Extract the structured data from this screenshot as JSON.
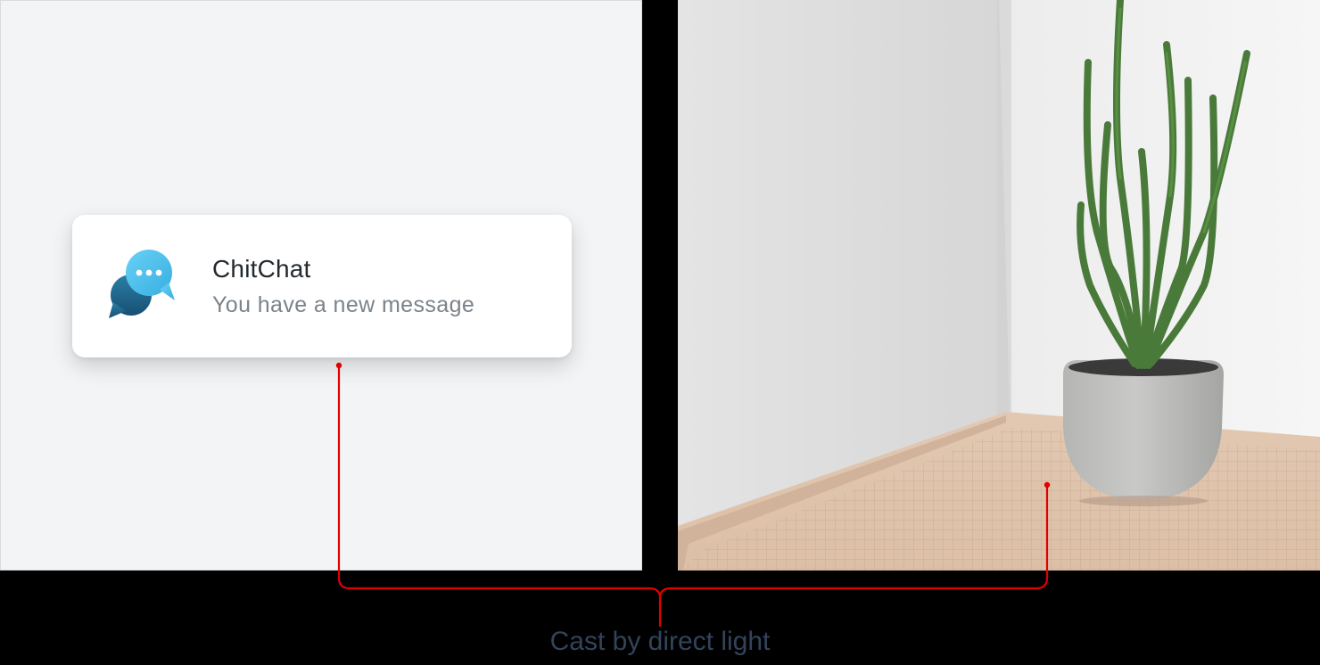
{
  "notification": {
    "app_name": "ChitChat",
    "message": "You have a new message",
    "icon": "chat-bubbles-icon"
  },
  "photo": {
    "subject": "potted-cactus-photo"
  },
  "annotation": {
    "caption": "Cast by direct light",
    "color": "#e00000"
  }
}
